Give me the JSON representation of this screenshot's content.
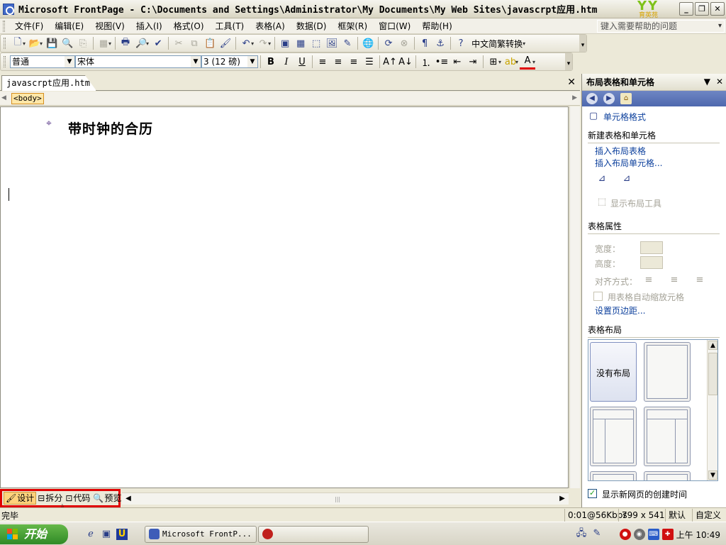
{
  "window": {
    "title": "Microsoft FrontPage - C:\\Documents and Settings\\Administrator\\My Documents\\My Web Sites\\javascrpt应用.htm",
    "brand_logo_text": "YY",
    "brand_logo_sub": "育英苑"
  },
  "menu": {
    "items": [
      "文件(F)",
      "编辑(E)",
      "视图(V)",
      "插入(I)",
      "格式(O)",
      "工具(T)",
      "表格(A)",
      "数据(D)",
      "框架(R)",
      "窗口(W)",
      "帮助(H)"
    ],
    "help_placeholder": "键入需要帮助的问题"
  },
  "toolbar": {
    "convert_label": "中文简繁转换",
    "style_value": "普通",
    "font_value": "宋体",
    "size_value": "3 (12 磅)"
  },
  "document": {
    "tab_label": "javascrpt应用.htm*",
    "body_tag": "<body>",
    "heading": "带时钟的合历"
  },
  "view_tabs": {
    "design": "设计",
    "split": "拆分",
    "code": "代码",
    "preview": "预览"
  },
  "status": {
    "left": "完毕",
    "speed": "0:01@56Kbps",
    "dimensions": "799 x 541",
    "default": "默认",
    "custom": "自定义"
  },
  "taskpane": {
    "title": "布局表格和单元格",
    "cell_format": "单元格格式",
    "new_section": "新建表格和单元格",
    "insert_layout_table": "插入布局表格",
    "insert_layout_cell": "插入布局单元格...",
    "show_layout_tool": "显示布局工具",
    "table_props": "表格属性",
    "width_label": "宽度：",
    "height_label": "高度：",
    "align_label": "对齐方式：",
    "auto_scale": "用表格自动缩放元格",
    "set_margins": "设置页边距...",
    "table_layout": "表格布局",
    "no_layout": "没有布局",
    "show_creation_time": "显示新网页的创建时间"
  },
  "taskbar": {
    "start": "开始",
    "frontpage_btn": "Microsoft FrontP...",
    "clock": "上午 10:49"
  }
}
